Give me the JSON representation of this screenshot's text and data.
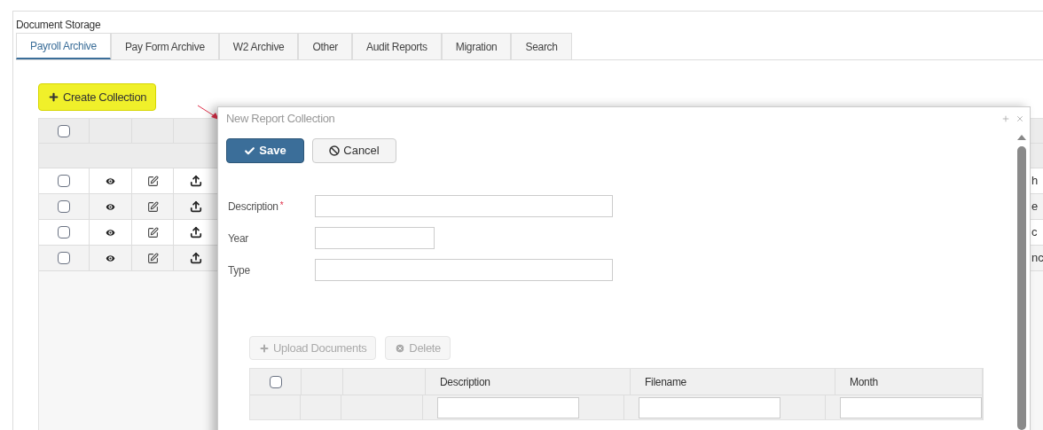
{
  "panel": {
    "title": "Document Storage"
  },
  "tabs": [
    {
      "label": "Payroll Archive",
      "selected": true
    },
    {
      "label": "Pay Form Archive",
      "selected": false
    },
    {
      "label": "W2 Archive",
      "selected": false
    },
    {
      "label": "Other",
      "selected": false
    },
    {
      "label": "Audit Reports",
      "selected": false
    },
    {
      "label": "Migration",
      "selected": false
    },
    {
      "label": "Search",
      "selected": false
    }
  ],
  "create_button": {
    "label": "Create Collection"
  },
  "collections": {
    "select_all_checked": false,
    "rows": [
      {
        "checked": false,
        "column_5": "h"
      },
      {
        "checked": false,
        "column_5": "e"
      },
      {
        "checked": false,
        "column_5": "c"
      },
      {
        "checked": false,
        "column_5": "nc"
      }
    ]
  },
  "dialog": {
    "title": "New Report Collection",
    "save": "Save",
    "cancel": "Cancel",
    "required_mark": "*",
    "fields": [
      {
        "label": "Description",
        "required": true,
        "kind": "text"
      },
      {
        "label": "Year",
        "required": false,
        "kind": "number"
      },
      {
        "label": "Type",
        "required": false,
        "kind": "text"
      }
    ],
    "upload_button": "Upload Documents",
    "delete_button": "Delete",
    "documents": {
      "select_all_checked": false,
      "columns": [
        "Description",
        "Filename",
        "Month"
      ]
    }
  }
}
